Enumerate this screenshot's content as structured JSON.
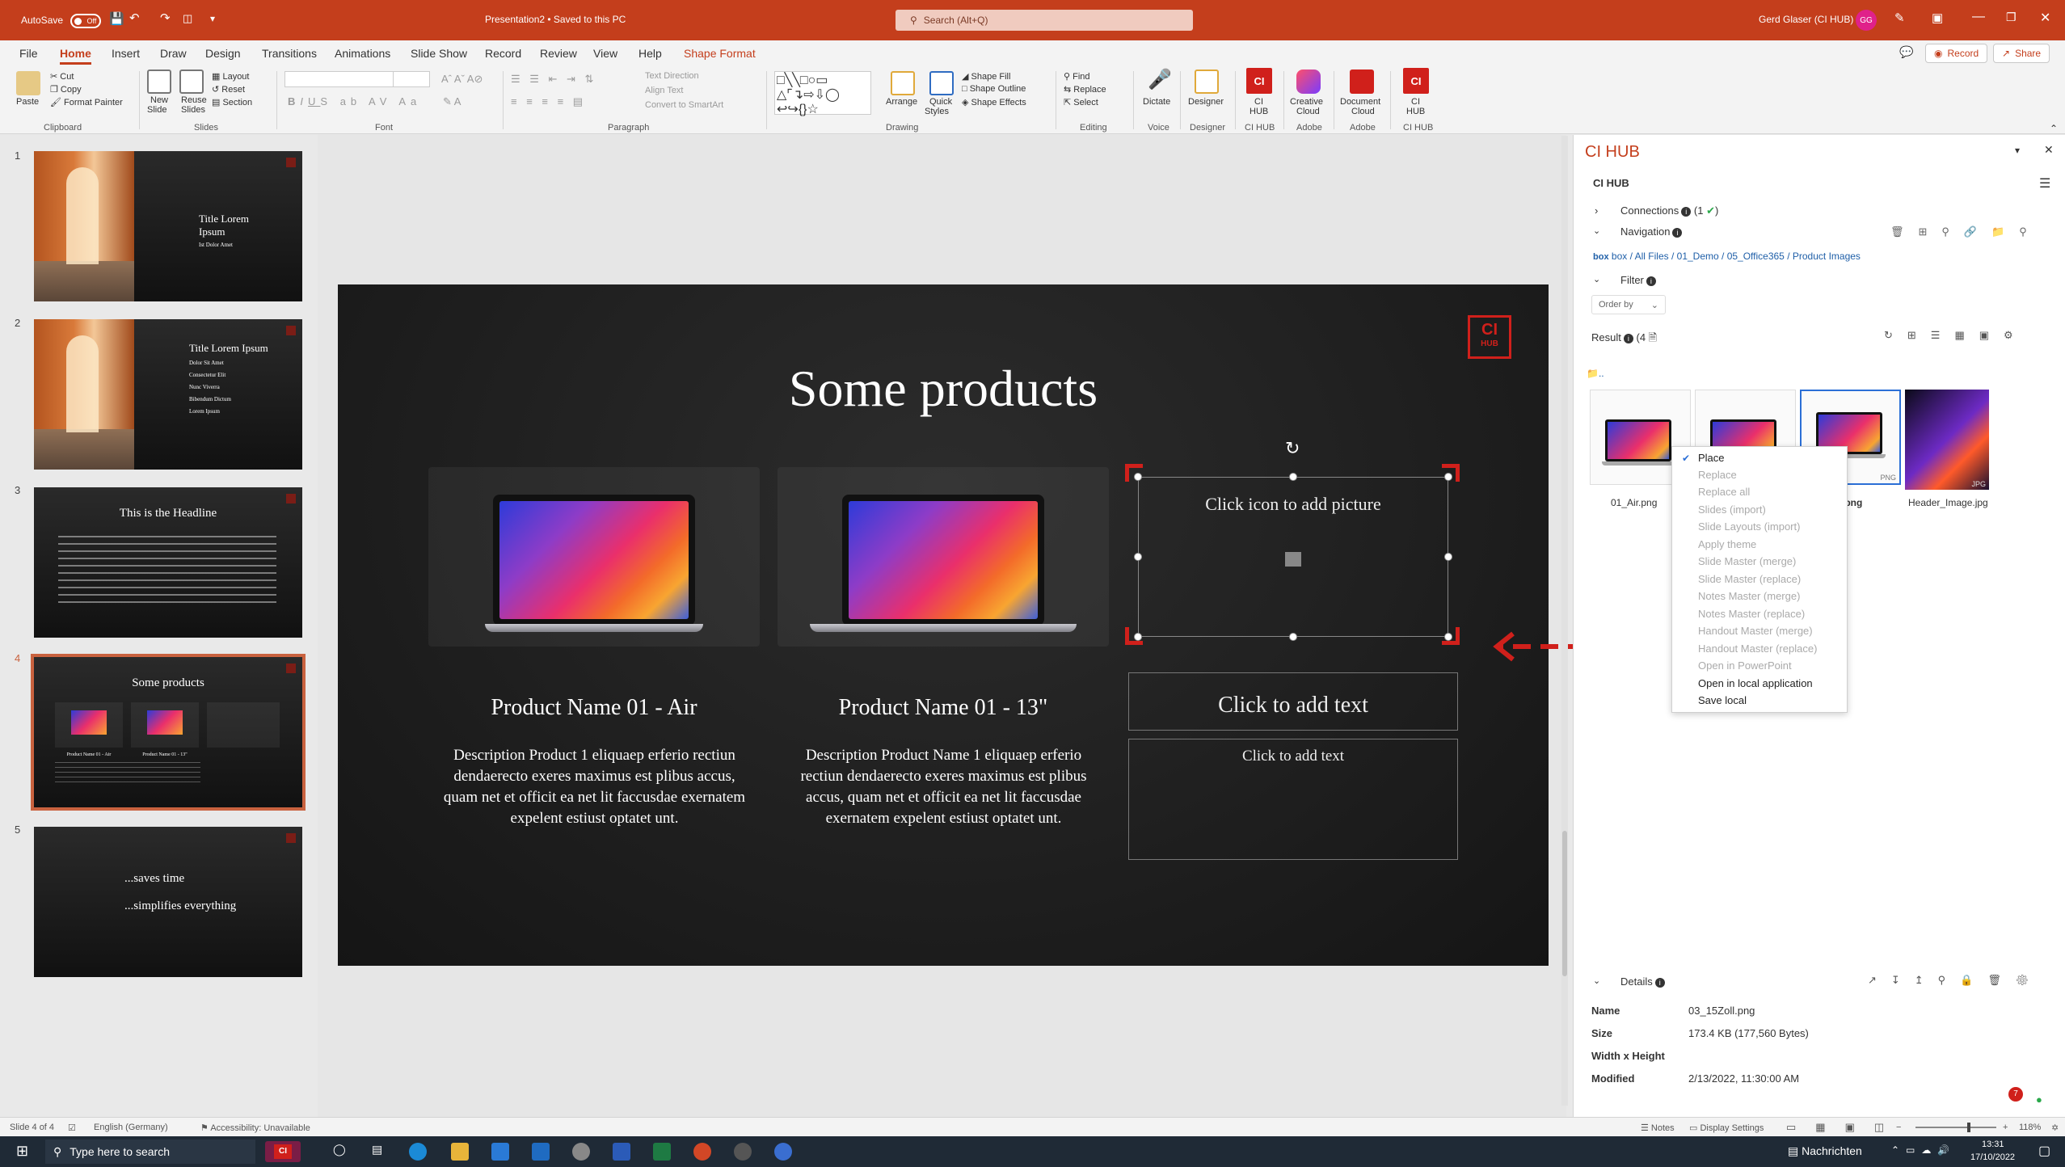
{
  "titlebar": {
    "autosave_label": "AutoSave",
    "autosave_state": "Off",
    "doc_title": "Presentation2 • Saved to this PC",
    "search_placeholder": "Search (Alt+Q)",
    "user_name": "Gerd Glaser (CI HUB)",
    "user_initials": "GG"
  },
  "menu": {
    "tabs": [
      "File",
      "Home",
      "Insert",
      "Draw",
      "Design",
      "Transitions",
      "Animations",
      "Slide Show",
      "Record",
      "Review",
      "View",
      "Help",
      "Shape Format"
    ],
    "active_tab": "Home",
    "record_button": "Record",
    "share_button": "Share"
  },
  "ribbon": {
    "clipboard": {
      "paste": "Paste",
      "cut": "Cut",
      "copy": "Copy",
      "format_painter": "Format Painter",
      "label": "Clipboard"
    },
    "slides": {
      "new_slide": "New",
      "new_slide2": "Slide",
      "reuse": "Reuse",
      "reuse2": "Slides",
      "layout": "Layout",
      "reset": "Reset",
      "section": "Section",
      "label": "Slides"
    },
    "font": {
      "label": "Font"
    },
    "paragraph": {
      "text_direction": "Text Direction",
      "align_text": "Align Text",
      "convert": "Convert to SmartArt",
      "label": "Paragraph"
    },
    "drawing": {
      "arrange": "Arrange",
      "quick_styles": "Quick",
      "quick_styles2": "Styles",
      "shape_fill": "Shape Fill",
      "shape_outline": "Shape Outline",
      "shape_effects": "Shape Effects",
      "label": "Drawing"
    },
    "editing": {
      "find": "Find",
      "replace": "Replace",
      "select": "Select",
      "label": "Editing"
    },
    "voice": {
      "dictate": "Dictate",
      "label": "Voice"
    },
    "designer": {
      "designer": "Designer",
      "label": "Designer"
    },
    "cihub": {
      "btn": "CI",
      "btn2": "HUB",
      "label": "CI HUB"
    },
    "adobe_cc": {
      "btn": "Creative",
      "btn2": "Cloud",
      "label": "Adobe"
    },
    "adobe_dc": {
      "btn": "Document",
      "btn2": "Cloud",
      "label": "Adobe"
    },
    "cihub2": {
      "btn": "CI",
      "btn2": "HUB",
      "label": "CI HUB"
    }
  },
  "thumbnails": [
    {
      "num": "1",
      "title": "Title Lorem",
      "title2": "Ipsum",
      "sub": "Ist Dolor Amet"
    },
    {
      "num": "2",
      "title": "Title Lorem Ipsum",
      "lines": [
        "Dolor Sit Amet",
        "Consectetur Elit",
        "Nunc Viverra",
        "Bibendum Dictum",
        "Lorem Ipsum"
      ]
    },
    {
      "num": "3",
      "title": "This is the Headline"
    },
    {
      "num": "4",
      "title": "Some products",
      "p1": "Product Name 01 - Air",
      "p2": "Product Name 01 - 13\""
    },
    {
      "num": "5",
      "line1": "...saves time",
      "line2": "...simplifies everything"
    }
  ],
  "slide": {
    "title": "Some products",
    "hub_logo_top": "CI",
    "hub_logo_bottom": "HUB",
    "products": [
      {
        "name": "Product Name 01 - Air",
        "desc": "Description Product 1 eliquaep erferio rectiun dendaerecto exeres maximus est plibus accus, quam net et officit ea net lit faccusdae exernatem expelent estiust optatet unt."
      },
      {
        "name": "Product Name 01 - 13\"",
        "desc": "Description Product Name 1 eliquaep erferio rectiun dendaerecto exeres maximus est plibus accus, quam net et officit ea net lit faccusdae exernatem expelent estiust optatet unt."
      }
    ],
    "picture_placeholder": "Click icon to add picture",
    "text_placeholder_title": "Click to add text",
    "text_placeholder_body": "Click to add text"
  },
  "cihub_panel": {
    "pane_title": "CI HUB",
    "header": "CI HUB",
    "connections_label": "Connections",
    "connections_count": "(1",
    "navigation_label": "Navigation",
    "breadcrumb": [
      "box",
      "All Files",
      "01_Demo",
      "05_Office365",
      "Product Images"
    ],
    "filter_label": "Filter",
    "order_by": "Order by",
    "result_label": "Result",
    "result_count": "(4",
    "folder_up": "..",
    "results": [
      {
        "name": "01_Air.png",
        "badge": ""
      },
      {
        "name": "",
        "badge": ""
      },
      {
        "name": "oll.png",
        "badge": "PNG"
      },
      {
        "name": "Header_Image.jpg",
        "badge": "JPG"
      }
    ],
    "context_menu": [
      {
        "label": "Place",
        "enabled": true,
        "checked": true
      },
      {
        "label": "Replace",
        "enabled": false
      },
      {
        "label": "Replace all",
        "enabled": false
      },
      {
        "label": "Slides (import)",
        "enabled": false
      },
      {
        "label": "Slide Layouts (import)",
        "enabled": false
      },
      {
        "label": "Apply theme",
        "enabled": false
      },
      {
        "label": "Slide Master (merge)",
        "enabled": false
      },
      {
        "label": "Slide Master (replace)",
        "enabled": false
      },
      {
        "label": "Notes Master (merge)",
        "enabled": false
      },
      {
        "label": "Notes Master (replace)",
        "enabled": false
      },
      {
        "label": "Handout Master (merge)",
        "enabled": false
      },
      {
        "label": "Handout Master (replace)",
        "enabled": false
      },
      {
        "label": "Open in PowerPoint",
        "enabled": false
      },
      {
        "label": "Open in local application",
        "enabled": true
      },
      {
        "label": "Save local",
        "enabled": true
      }
    ],
    "details_label": "Details",
    "details": [
      {
        "key": "Name",
        "value": "03_15Zoll.png"
      },
      {
        "key": "Size",
        "value": "173.4 KB (177,560 Bytes)"
      },
      {
        "key": "Width x Height",
        "value": ""
      },
      {
        "key": "Modified",
        "value": "2/13/2022, 11:30:00 AM"
      }
    ],
    "notification_count": "7"
  },
  "statusbar": {
    "slide_info": "Slide 4 of 4",
    "language": "English (Germany)",
    "accessibility": "Accessibility: Unavailable",
    "notes": "Notes",
    "display_settings": "Display Settings",
    "zoom": "118%"
  },
  "taskbar": {
    "search_placeholder": "Type here to search",
    "news": "Nachrichten",
    "time": "13:31",
    "date": "17/10/2022"
  },
  "colors": {
    "accent": "#c43e1c",
    "brand_red": "#d0201b",
    "link_blue": "#1f5fa8",
    "selection_blue": "#2b6fd6"
  }
}
